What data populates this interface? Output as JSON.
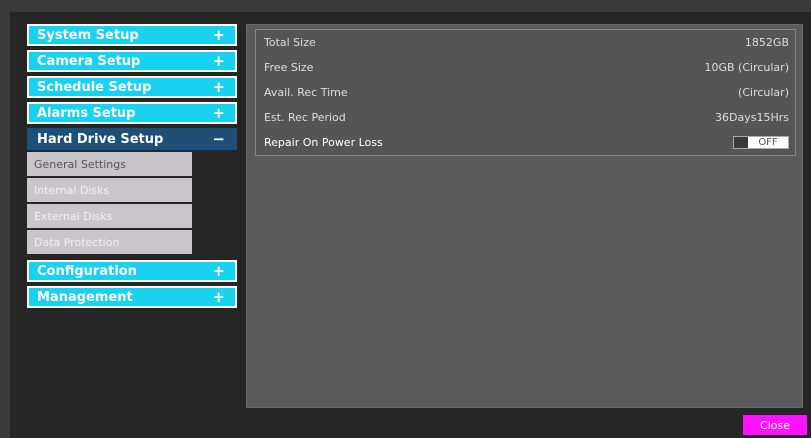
{
  "sidebar": {
    "menu": [
      {
        "label": "System Setup",
        "sign": "+"
      },
      {
        "label": "Camera Setup",
        "sign": "+"
      },
      {
        "label": "Schedule Setup",
        "sign": "+"
      },
      {
        "label": "Alarms Setup",
        "sign": "+"
      },
      {
        "label": "Hard Drive Setup",
        "sign": "−"
      },
      {
        "label": "Configuration",
        "sign": "+"
      },
      {
        "label": "Management",
        "sign": "+"
      }
    ],
    "submenu": [
      {
        "label": "General Settings"
      },
      {
        "label": "Internal Disks"
      },
      {
        "label": "External Disks"
      },
      {
        "label": "Data Protection"
      }
    ]
  },
  "panel": {
    "rows": [
      {
        "label": "Total Size",
        "value": "1852GB"
      },
      {
        "label": "Free Size",
        "value": "10GB (Circular)"
      },
      {
        "label": "Avail. Rec Time",
        "value": "(Circular)"
      },
      {
        "label": "Est. Rec Period",
        "value": "36Days15Hrs"
      },
      {
        "label": "Repair On Power Loss",
        "value": "OFF"
      }
    ]
  },
  "footer": {
    "close_label": "Close"
  },
  "colors": {
    "accent": "#19d2f0",
    "active": "#1e4f78",
    "close": "#ff10ff"
  }
}
